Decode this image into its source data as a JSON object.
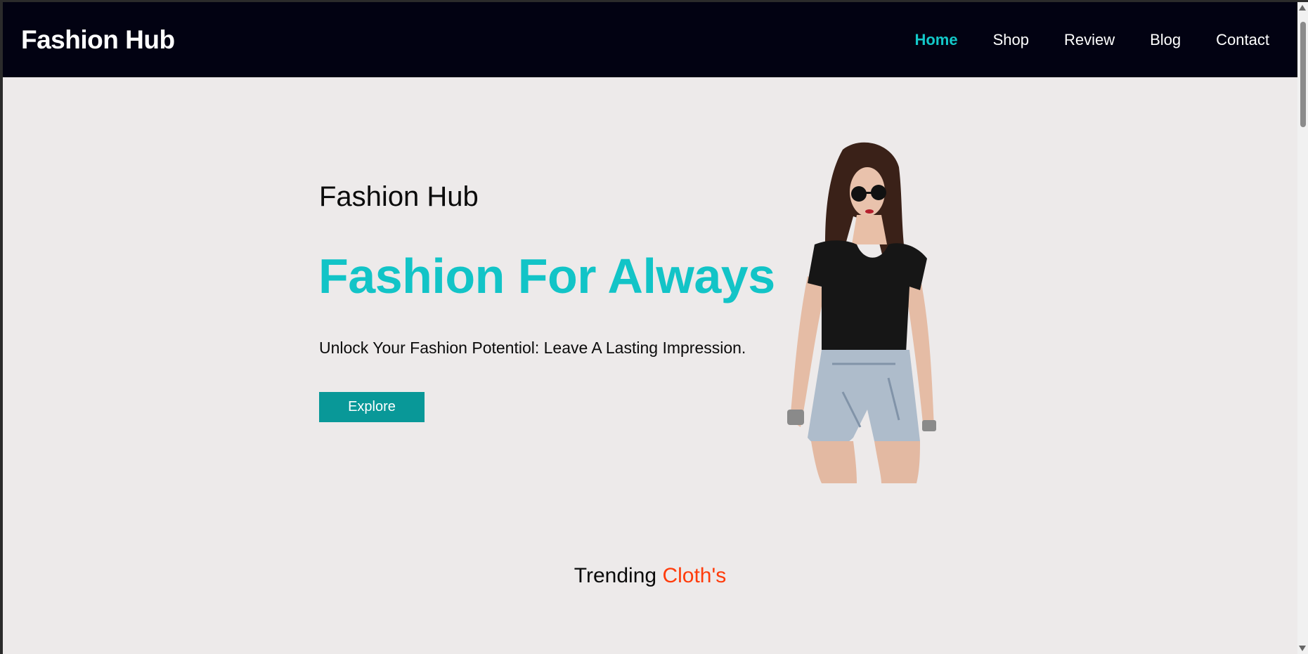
{
  "header": {
    "brand": "Fashion Hub",
    "nav": [
      {
        "label": "Home",
        "active": true
      },
      {
        "label": "Shop",
        "active": false
      },
      {
        "label": "Review",
        "active": false
      },
      {
        "label": "Blog",
        "active": false
      },
      {
        "label": "Contact",
        "active": false
      }
    ]
  },
  "hero": {
    "subtitle": "Fashion Hub",
    "title": "Fashion For Always",
    "tagline": "Unlock Your Fashion Potentiol: Leave A Lasting Impression.",
    "button_label": "Explore",
    "image": "model-photo"
  },
  "trending": {
    "prefix": "Trending",
    "accent": "Cloth's"
  },
  "colors": {
    "accent": "#12c4c7",
    "button": "#099898",
    "header_bg": "#020212",
    "page_bg": "#edeaea",
    "trending_accent": "#ff3b0a"
  }
}
